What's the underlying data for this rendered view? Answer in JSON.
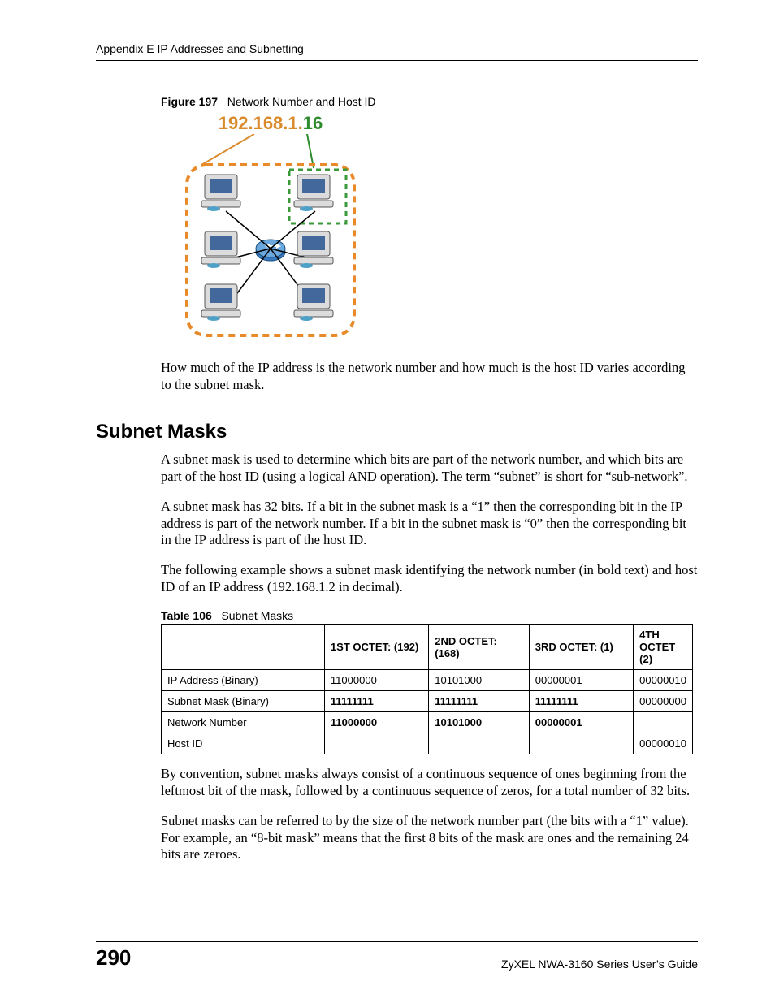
{
  "header": {
    "text": "Appendix E IP Addresses and Subnetting"
  },
  "figure": {
    "label": "Figure 197",
    "title": "Network Number and Host ID",
    "ip_network_part": "192.168.1.",
    "ip_host_part": "16"
  },
  "para1": "How much of the IP address is the network number and how much is the host ID varies according to the subnet mask.",
  "section_heading": "Subnet Masks",
  "para2": "A subnet mask is used to determine which bits are part of the network number, and which bits are part of the host ID (using a logical AND operation). The term “subnet” is short for “sub-network”.",
  "para3": "A subnet mask has 32 bits. If a bit in the subnet mask is a “1” then the corresponding bit in the IP address is part of the network number. If a bit in the subnet mask is “0” then the corresponding bit in the IP address is part of the host ID.",
  "para4": "The following example shows a subnet mask identifying the network number (in bold text) and host ID of an IP address (192.168.1.2 in decimal).",
  "table": {
    "label": "Table 106",
    "title": "Subnet Masks",
    "headers": [
      "",
      "1ST OCTET: (192)",
      "2ND OCTET: (168)",
      "3RD OCTET: (1)",
      "4TH OCTET (2)"
    ],
    "rows": [
      {
        "label": "IP Address (Binary)",
        "c1": "11000000",
        "c2": "10101000",
        "c3": "00000001",
        "c4": "00000010",
        "bold": [
          false,
          false,
          false,
          false
        ]
      },
      {
        "label": "Subnet Mask (Binary)",
        "c1": "11111111",
        "c2": "11111111",
        "c3": "11111111",
        "c4": "00000000",
        "bold": [
          true,
          true,
          true,
          false
        ]
      },
      {
        "label": "Network Number",
        "c1": "11000000",
        "c2": "10101000",
        "c3": "00000001",
        "c4": "",
        "bold": [
          true,
          true,
          true,
          false
        ]
      },
      {
        "label": "Host ID",
        "c1": "",
        "c2": "",
        "c3": "",
        "c4": "00000010",
        "bold": [
          false,
          false,
          false,
          false
        ]
      }
    ]
  },
  "para5": "By convention, subnet masks always consist of a continuous sequence of ones beginning from the leftmost bit of the mask, followed by a continuous sequence of zeros, for a total number of 32 bits.",
  "para6": "Subnet masks can be referred to by the size of the network number part (the bits with a “1” value). For example, an “8-bit mask” means that the first 8 bits of the mask are ones and the remaining 24 bits are zeroes.",
  "footer": {
    "page": "290",
    "doc": "ZyXEL NWA-3160 Series User’s Guide"
  }
}
